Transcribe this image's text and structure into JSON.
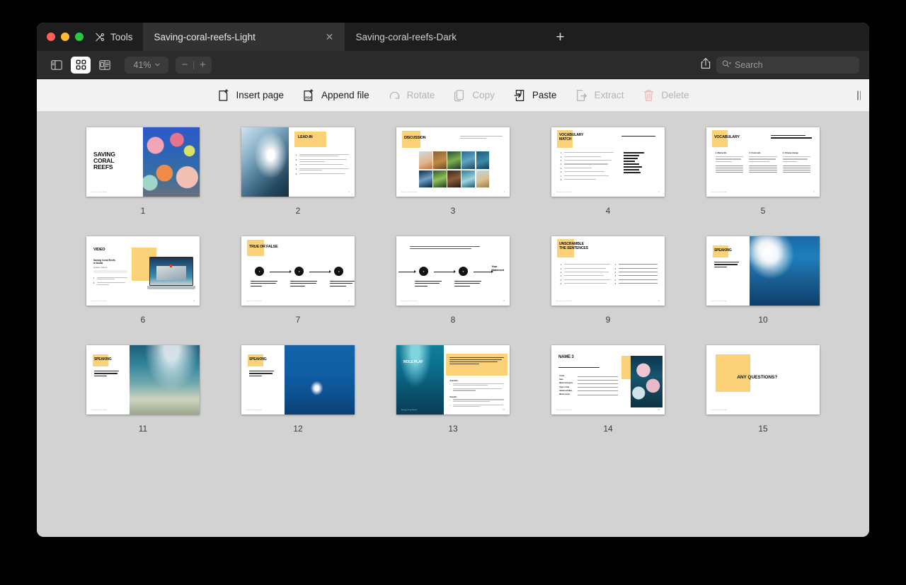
{
  "window": {
    "traffic_lights": [
      "close",
      "minimize",
      "maximize"
    ],
    "tools_label": "Tools",
    "tabs": [
      {
        "title": "Saving-coral-reefs-Light",
        "active": true
      },
      {
        "title": "Saving-coral-reefs-Dark",
        "active": false
      }
    ],
    "new_tab_label": "+"
  },
  "toolbar": {
    "view_modes": [
      {
        "name": "sidebar-view",
        "selected": false
      },
      {
        "name": "grid-view",
        "selected": true
      },
      {
        "name": "page-view",
        "selected": false
      }
    ],
    "zoom_level": "41%",
    "zoom_out_label": "−",
    "zoom_separator": "|",
    "zoom_in_label": "+",
    "share_label": "Share",
    "search_placeholder": "Search",
    "search_value": ""
  },
  "actions": [
    {
      "label": "Insert page",
      "icon": "insert-page-icon",
      "enabled": true
    },
    {
      "label": "Append file",
      "icon": "append-file-icon",
      "enabled": true
    },
    {
      "label": "Rotate",
      "icon": "rotate-icon",
      "enabled": false
    },
    {
      "label": "Copy",
      "icon": "copy-icon",
      "enabled": false
    },
    {
      "label": "Paste",
      "icon": "paste-icon",
      "enabled": true
    },
    {
      "label": "Extract",
      "icon": "extract-icon",
      "enabled": false
    },
    {
      "label": "Delete",
      "icon": "delete-icon",
      "enabled": false
    }
  ],
  "colors": {
    "accent_yellow": "#fbd277",
    "canvas_bg": "#d2d2d2",
    "titlebar_bg": "#1e1e1e",
    "toolbar_bg": "#2b2b2b",
    "actionbar_bg": "#f2f2f2"
  },
  "document": {
    "page_count": 15,
    "footer_text": "Saving Coral Reefs",
    "pages": [
      {
        "number": "1",
        "title": "SAVING\nCORAL\nREEFS",
        "layout": "cover-right-photo",
        "photo": "coral-reef-colorful"
      },
      {
        "number": "2",
        "title": "LEAD-IN",
        "layout": "photo-left-list",
        "photo": "ocean-wave",
        "items": [
          "Have you ever been to the ocean? If so, where did you go and what did you do there?",
          "Have you ever tried snorkeling or scuba diving? What was it like?",
          "Can you name three animals that live in the ocean?",
          "How do you think climate change is affecting the oceans?",
          "What are coral reefs, and why are they important?"
        ]
      },
      {
        "number": "3",
        "title": "DISCUSSION",
        "layout": "photo-grid",
        "prompt": "Can you name the things found in the reef literature? It is a ...",
        "photo_count": 10
      },
      {
        "number": "4",
        "title": "VOCABULARY\nMATCH",
        "layout": "two-column-match",
        "prompt": "Match the words and definitions",
        "items": [
          "To keep something in its original state or in good condition",
          "A group of similar animals or plants",
          "When something becomes weak after becoming worse",
          "The process of getting the best solution for hazard",
          "A term or a team is using",
          "Simple, plain words that grow in water",
          "To completely remove or destroy something",
          "Get a serious rise or threat"
        ],
        "words": [
          "grave danger",
          "preserve",
          "species",
          "algae",
          "wipe out",
          "bleaching",
          "resilient",
          "nutrition"
        ]
      },
      {
        "number": "5",
        "title": "VOCABULARY",
        "layout": "three-column-define",
        "prompt": "Do these definitions make sense?\nIf not, rewrite them and provide examples.",
        "columns": [
          "1. Marine life",
          "2. Coral reefs",
          "3. Climate change"
        ]
      },
      {
        "number": "6",
        "title": "VIDEO",
        "layout": "video-laptop",
        "subtitle": "Saving Coral Reefs\nin Dubai",
        "duration": "Duration: 3:28 min",
        "items": [
          "Watch the video and listen for the key words.",
          "Complete the tasks on the next slide."
        ]
      },
      {
        "number": "7",
        "title": "TRUE OR FALSE",
        "layout": "timeline-3",
        "steps": [
          {
            "n": "1",
            "text": "There are hundreds of species of corals in the world."
          },
          {
            "n": "2",
            "text": "The primary threat to coral reefs is pollution from human activities."
          },
          {
            "n": "3",
            "text": "The team at Coral Vita in Dubai is working to destroy coral reefs."
          }
        ]
      },
      {
        "number": "8",
        "title": "",
        "layout": "timeline-2",
        "quote": "\"Covering only 1% of our oceans, coral reefs support a quarter of all marine life and protect our coastlines from storm damage.\"",
        "statement_label": "Your\nStatement",
        "steps": [
          {
            "n": "4",
            "text": "Coral Vita grows coral in tanks to recreate wild conditions."
          },
          {
            "n": "5",
            "text": "Once matured, the corals are left in the tanks to continue growing there."
          }
        ]
      },
      {
        "number": "9",
        "title": "UNSCRAMBLE\nTHE SENTENCES",
        "layout": "unscramble",
        "items": [
          "Climate change / coral / on are the coral / a big role in",
          "Coral / the reef but / coral / will / put for / weather",
          "Symbiotic / in the reef of species / there are / of corals",
          "Reef bleaching / all the / climate change / the ocean / and",
          "Almost 50% / about 90% / has died / of coral / across the world",
          "Threaten / makes it / is on / to climate change / reacts / critical"
        ]
      },
      {
        "number": "10",
        "title": "SPEAKING",
        "layout": "text-left-photo-right",
        "prompt": "Look at the picture. Discuss the issue it portrays. Share your opinion.",
        "photo": "ocean-plastic-pollution"
      },
      {
        "number": "11",
        "title": "SPEAKING",
        "layout": "text-left-photo-right",
        "prompt": "Look at the picture. Discuss the issue it portrays. Share your opinion.",
        "photo": "bleached-coral-reef"
      },
      {
        "number": "12",
        "title": "SPEAKING",
        "layout": "text-left-photo-right",
        "prompt": "Look at the picture. Discuss the issue it portrays. Share your opinion.",
        "photo": "boat-aerial-ocean"
      },
      {
        "number": "13",
        "title": "ROLE PLAY",
        "layout": "photo-left-rolepaly",
        "photo": "underwater-reef-diver",
        "callout": "One student will play the role of a journalist, and another will play the role of a Coral Vita scientist. Follow these steps to prepare and conduct the interview.",
        "sections": [
          {
            "head": "Journalist",
            "items": [
              "Prepare Questions: Think of clear questions about coral reefs, climate change, and how to save them.",
              "Conduct Interview: Ask the questions and listen carefully to the answers."
            ]
          },
          {
            "head": "Scientist",
            "items": [
              "Describe Your Role: Explain your work at Coral Vita. Think about your job and why coral reefs matter.",
              "Answer Questions: Talk with passion about your work and why it's important to save coral reefs."
            ]
          }
        ]
      },
      {
        "number": "14",
        "title": "NAME 3",
        "layout": "name-three",
        "prompt": "Name 3 words related to each category.",
        "rows": [
          "Corals",
          "Seas",
          "Marine biologists",
          "Types of fish",
          "Human activities",
          "Marine issues"
        ],
        "photo": "pink-coral-macro"
      },
      {
        "number": "15",
        "title": "ANY QUESTIONS?",
        "layout": "closing"
      }
    ]
  }
}
